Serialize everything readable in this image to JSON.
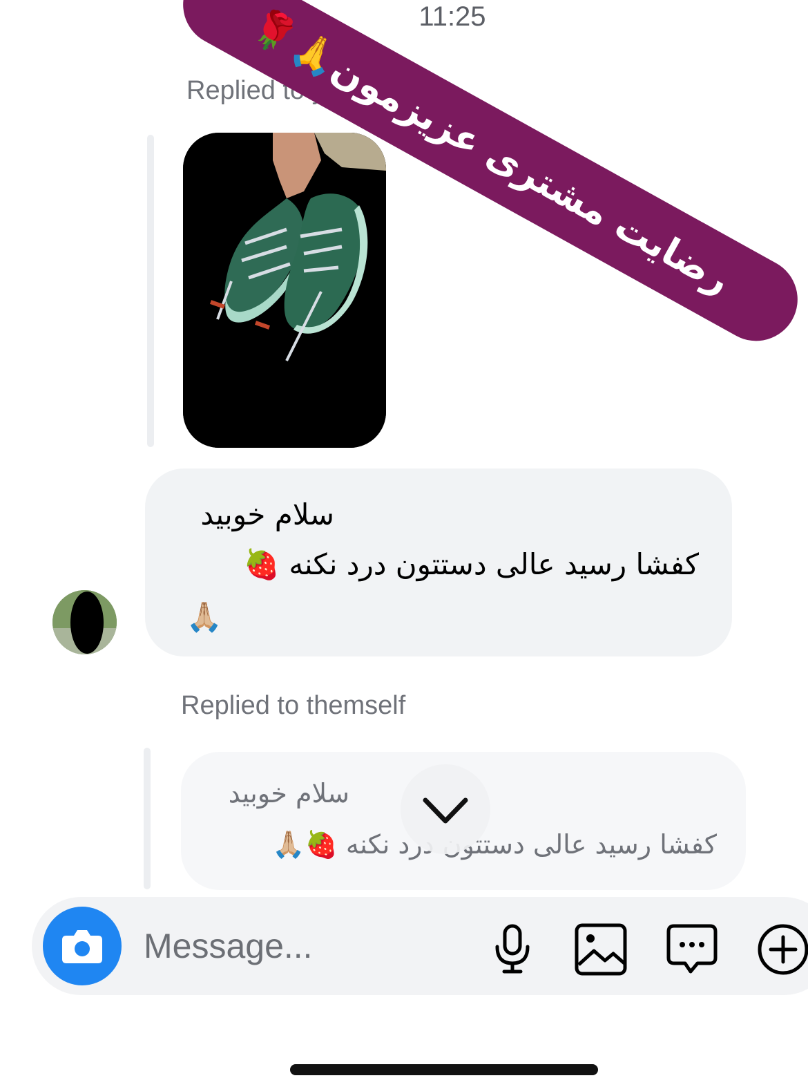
{
  "status_bar": {
    "time": "11:25"
  },
  "promo_banner": {
    "text": "رضایت مشتری عزیزمون🙏🌹",
    "color": "#7b1a5e"
  },
  "thread": {
    "reply_label_1": "Replied to you",
    "shared_image": {
      "description_icon": "sneaker-photo"
    },
    "message_1": {
      "line1": "سلام خوبید",
      "line2": "کفشا رسید عالی دستتون درد نکنه 🍓",
      "line3": "🙏🏼"
    },
    "reply_label_2": "Replied to themself",
    "quoted_message": {
      "line1": "سلام خوبید",
      "line2": "کفشا رسید عالی دستتون درد نکنه 🍓🙏🏼"
    }
  },
  "composer": {
    "placeholder": "Message...",
    "camera_icon": "camera-icon",
    "tools": [
      "microphone-icon",
      "image-icon",
      "sticker-chat-icon",
      "plus-icon"
    ],
    "accent": "#1f86f2"
  }
}
